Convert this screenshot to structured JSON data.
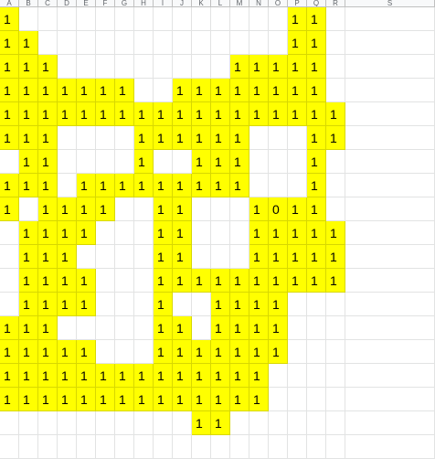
{
  "sheet": {
    "column_headers": [
      "A",
      "B",
      "C",
      "D",
      "E",
      "F",
      "G",
      "H",
      "I",
      "J",
      "K",
      "L",
      "M",
      "N",
      "O",
      "P",
      "Q",
      "R",
      "S"
    ],
    "fill_color": "#ffff00",
    "rows": [
      [
        "1",
        "",
        "",
        "",
        "",
        "",
        "",
        "",
        "",
        "",
        "",
        "",
        "",
        "",
        "",
        "1",
        "1",
        "",
        ""
      ],
      [
        "1",
        "1",
        "",
        "",
        "",
        "",
        "",
        "",
        "",
        "",
        "",
        "",
        "",
        "",
        "",
        "1",
        "1",
        "",
        ""
      ],
      [
        "1",
        "1",
        "1",
        "",
        "",
        "",
        "",
        "",
        "",
        "",
        "",
        "",
        "1",
        "1",
        "1",
        "1",
        "1",
        "",
        ""
      ],
      [
        "1",
        "1",
        "1",
        "1",
        "1",
        "1",
        "1",
        "",
        "",
        "1",
        "1",
        "1",
        "1",
        "1",
        "1",
        "1",
        "1",
        "",
        ""
      ],
      [
        "1",
        "1",
        "1",
        "1",
        "1",
        "1",
        "1",
        "1",
        "1",
        "1",
        "1",
        "1",
        "1",
        "1",
        "1",
        "1",
        "1",
        "1",
        ""
      ],
      [
        "1",
        "1",
        "1",
        "",
        "",
        "",
        "",
        "1",
        "1",
        "1",
        "1",
        "1",
        "1",
        "",
        "",
        "",
        "1",
        "1",
        ""
      ],
      [
        "",
        "1",
        "1",
        "",
        "",
        "",
        "",
        "1",
        "",
        "",
        "1",
        "1",
        "1",
        "",
        "",
        "",
        "1",
        "",
        ""
      ],
      [
        "1",
        "1",
        "1",
        "",
        "1",
        "1",
        "1",
        "1",
        "1",
        "1",
        "1",
        "1",
        "1",
        "",
        "",
        "",
        "1",
        "",
        ""
      ],
      [
        "1",
        "",
        "1",
        "1",
        "1",
        "1",
        "",
        "",
        "1",
        "1",
        "",
        "",
        "",
        "1",
        "0",
        "1",
        "1",
        "",
        ""
      ],
      [
        "",
        "1",
        "1",
        "1",
        "1",
        "",
        "",
        "",
        "1",
        "1",
        "",
        "",
        "",
        "1",
        "1",
        "1",
        "1",
        "1",
        ""
      ],
      [
        "",
        "1",
        "1",
        "1",
        "",
        "",
        "",
        "",
        "1",
        "1",
        "",
        "",
        "",
        "1",
        "1",
        "1",
        "1",
        "1",
        ""
      ],
      [
        "",
        "1",
        "1",
        "1",
        "1",
        "",
        "",
        "",
        "1",
        "1",
        "1",
        "1",
        "1",
        "1",
        "1",
        "1",
        "1",
        "1",
        ""
      ],
      [
        "",
        "1",
        "1",
        "1",
        "1",
        "",
        "",
        "",
        "1",
        "",
        "",
        "1",
        "1",
        "1",
        "1",
        "",
        "",
        "",
        ""
      ],
      [
        "1",
        "1",
        "1",
        "",
        "",
        "",
        "",
        "",
        "1",
        "1",
        "",
        "1",
        "1",
        "1",
        "1",
        "",
        "",
        "",
        ""
      ],
      [
        "1",
        "1",
        "1",
        "1",
        "1",
        "",
        "",
        "",
        "1",
        "1",
        "1",
        "1",
        "1",
        "1",
        "1",
        "",
        "",
        "",
        ""
      ],
      [
        "1",
        "1",
        "1",
        "1",
        "1",
        "1",
        "1",
        "1",
        "1",
        "1",
        "1",
        "1",
        "1",
        "1",
        "",
        "",
        "",
        "",
        ""
      ],
      [
        "1",
        "1",
        "1",
        "1",
        "1",
        "1",
        "1",
        "1",
        "1",
        "1",
        "1",
        "1",
        "1",
        "1",
        "",
        "",
        "",
        "",
        ""
      ],
      [
        "",
        "",
        "",
        "",
        "",
        "",
        "",
        "",
        "",
        "",
        "1",
        "1",
        "",
        "",
        "",
        "",
        "",
        "",
        ""
      ],
      [
        "",
        "",
        "",
        "",
        "",
        "",
        "",
        "",
        "",
        "",
        "",
        "",
        "",
        "",
        "",
        "",
        "",
        "",
        ""
      ]
    ]
  }
}
